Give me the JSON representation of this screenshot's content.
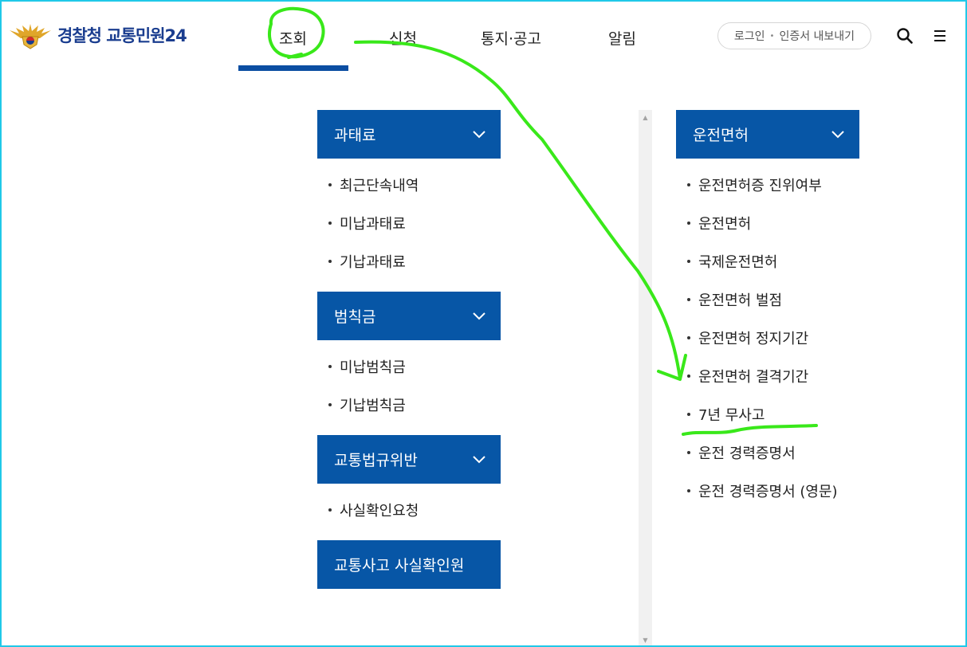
{
  "header": {
    "logo_text": "경찰청 교통민원24",
    "nav": [
      {
        "label": "조회"
      },
      {
        "label": "신청"
      },
      {
        "label": "통지·공고"
      },
      {
        "label": "알림"
      }
    ],
    "login_label": "로그인",
    "cert_label": "인증서 내보내기"
  },
  "menu": {
    "sections_left": [
      {
        "title": "과태료",
        "items": [
          "최근단속내역",
          "미납과태료",
          "기납과태료"
        ]
      },
      {
        "title": "범칙금",
        "items": [
          "미납범칙금",
          "기납범칙금"
        ]
      },
      {
        "title": "교통법규위반",
        "items": [
          "사실확인요청"
        ]
      },
      {
        "title": "교통사고 사실확인원",
        "items": []
      }
    ],
    "section_right": {
      "title": "운전면허",
      "items": [
        "운전면허증 진위여부",
        "운전면허",
        "국제운전면허",
        "운전면허 벌점",
        "운전면허 정지기간",
        "운전면허 결격기간",
        "7년 무사고",
        "운전 경력증명서",
        "운전 경력증명서 (영문)"
      ]
    }
  },
  "colors": {
    "brand_blue": "#0756a6",
    "nav_active_bar": "#0b4ea2",
    "annotation_green": "#39e81a",
    "frame_border": "#20c9e8"
  },
  "icons": {
    "search": "search-icon",
    "menu": "hamburger-menu-icon",
    "chevron": "chevron-down-icon"
  }
}
